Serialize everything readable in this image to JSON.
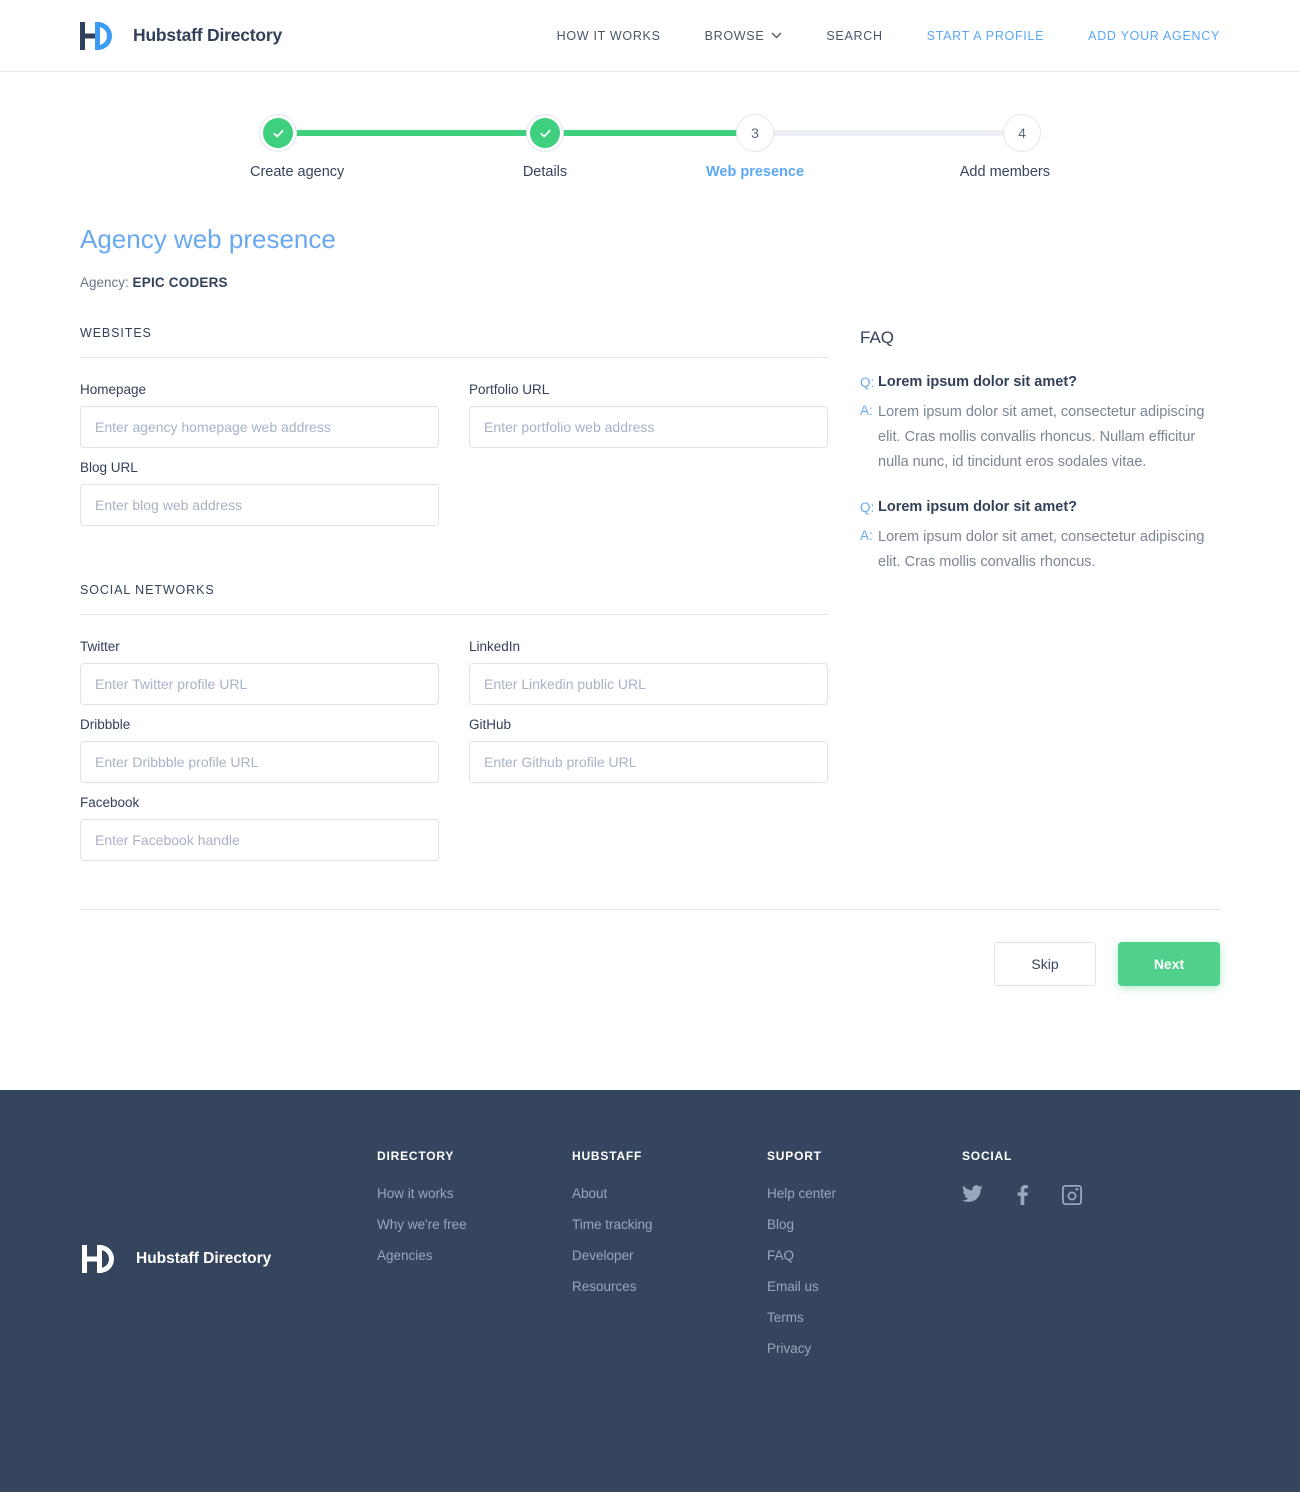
{
  "header": {
    "brand_name": "Hubstaff Directory",
    "logo_icon": "hubstaff-directory-logo",
    "nav": [
      {
        "label": "HOW IT WORKS",
        "accent": false,
        "caret": false
      },
      {
        "label": "BROWSE",
        "accent": false,
        "caret": true
      },
      {
        "label": "SEARCH",
        "accent": false,
        "caret": false
      },
      {
        "label": "START A PROFILE",
        "accent": true,
        "caret": false
      },
      {
        "label": "ADD YOUR AGENCY",
        "accent": true,
        "caret": false
      }
    ]
  },
  "stepper": {
    "steps": [
      {
        "number": "1",
        "label": "Create agency",
        "state": "done"
      },
      {
        "number": "2",
        "label": "Details",
        "state": "done"
      },
      {
        "number": "3",
        "label": "Web presence",
        "state": "current"
      },
      {
        "number": "4",
        "label": "Add members",
        "state": "upcoming"
      }
    ]
  },
  "main": {
    "title": "Agency web presence",
    "agency_label": "Agency:",
    "agency_name": "EPIC CODERS",
    "websites": {
      "heading": "WEBSITES",
      "fields": [
        {
          "label": "Homepage",
          "placeholder": "Enter agency homepage web address",
          "value": ""
        },
        {
          "label": "Portfolio URL",
          "placeholder": "Enter portfolio web address",
          "value": ""
        },
        {
          "label": "Blog URL",
          "placeholder": "Enter blog web address",
          "value": ""
        }
      ]
    },
    "social_networks": {
      "heading": "SOCIAL NETWORKS",
      "fields": [
        {
          "label": "Twitter",
          "placeholder": "Enter Twitter profile URL",
          "value": ""
        },
        {
          "label": "LinkedIn",
          "placeholder": "Enter Linkedin public URL",
          "value": ""
        },
        {
          "label": "Dribbble",
          "placeholder": "Enter Dribbble profile URL",
          "value": ""
        },
        {
          "label": "GitHub",
          "placeholder": "Enter Github profile URL",
          "value": ""
        },
        {
          "label": "Facebook",
          "placeholder": "Enter Facebook handle",
          "value": ""
        }
      ]
    },
    "actions": {
      "skip_label": "Skip",
      "next_label": "Next"
    }
  },
  "faq": {
    "title": "FAQ",
    "q_tag": "Q:",
    "a_tag": "A:",
    "items": [
      {
        "question": "Lorem ipsum dolor sit amet?",
        "answer": "Lorem ipsum dolor sit amet, consectetur adipiscing elit. Cras mollis convallis rhoncus. Nullam efficitur nulla nunc, id tincidunt eros sodales vitae."
      },
      {
        "question": "Lorem ipsum dolor sit amet?",
        "answer": "Lorem ipsum dolor sit amet, consectetur adipiscing elit. Cras mollis convallis rhoncus."
      }
    ]
  },
  "footer": {
    "brand_name": "Hubstaff Directory",
    "logo_icon": "hubstaff-directory-logo-white",
    "columns": [
      {
        "title": "DIRECTORY",
        "links": [
          "How it works",
          "Why we're free",
          "Agencies"
        ]
      },
      {
        "title": "HUBSTAFF",
        "links": [
          "About",
          "Time tracking",
          "Developer",
          "Resources"
        ]
      },
      {
        "title": "SUPORT",
        "links": [
          "Help center",
          "Blog",
          "FAQ",
          "Email us",
          "Terms",
          "Privacy"
        ]
      }
    ],
    "social": {
      "title": "SOCIAL",
      "icons": [
        "twitter-icon",
        "facebook-icon",
        "instagram-icon"
      ]
    }
  },
  "colors": {
    "accent_blue": "#5ca8f7",
    "title_blue": "#6aa9f0",
    "success_green": "#3ed07e",
    "button_green": "#4fd18b",
    "navy": "#32415a",
    "footer_bg": "#34455d"
  }
}
